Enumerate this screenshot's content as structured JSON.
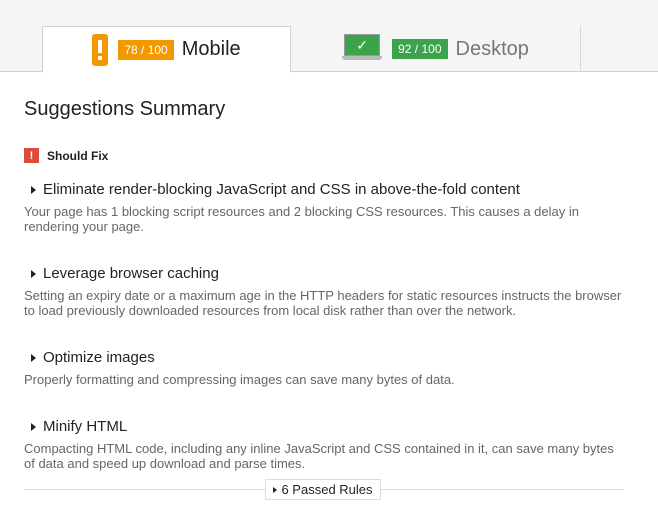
{
  "tabs": {
    "mobile": {
      "score": "78 / 100",
      "label": "Mobile",
      "score_color": "#f39800"
    },
    "desktop": {
      "score": "92 / 100",
      "label": "Desktop",
      "score_color": "#3ba34a"
    }
  },
  "summary": {
    "title": "Suggestions Summary",
    "should_fix_label": "Should Fix",
    "warning_color": "#dd4b39",
    "rules": [
      {
        "title": "Eliminate render-blocking JavaScript and CSS in above-the-fold content",
        "description": "Your page has 1 blocking script resources and 2 blocking CSS resources. This causes a delay in rendering your page."
      },
      {
        "title": "Leverage browser caching",
        "description": "Setting an expiry date or a maximum age in the HTTP headers for static resources instructs the browser to load previously downloaded resources from local disk rather than over the network."
      },
      {
        "title": "Optimize images",
        "description": "Properly formatting and compressing images can save many bytes of data."
      },
      {
        "title": "Minify HTML",
        "description": "Compacting HTML code, including any inline JavaScript and CSS contained in it, can save many bytes of data and speed up download and parse times."
      }
    ],
    "passed_rules_label": "6 Passed Rules"
  }
}
